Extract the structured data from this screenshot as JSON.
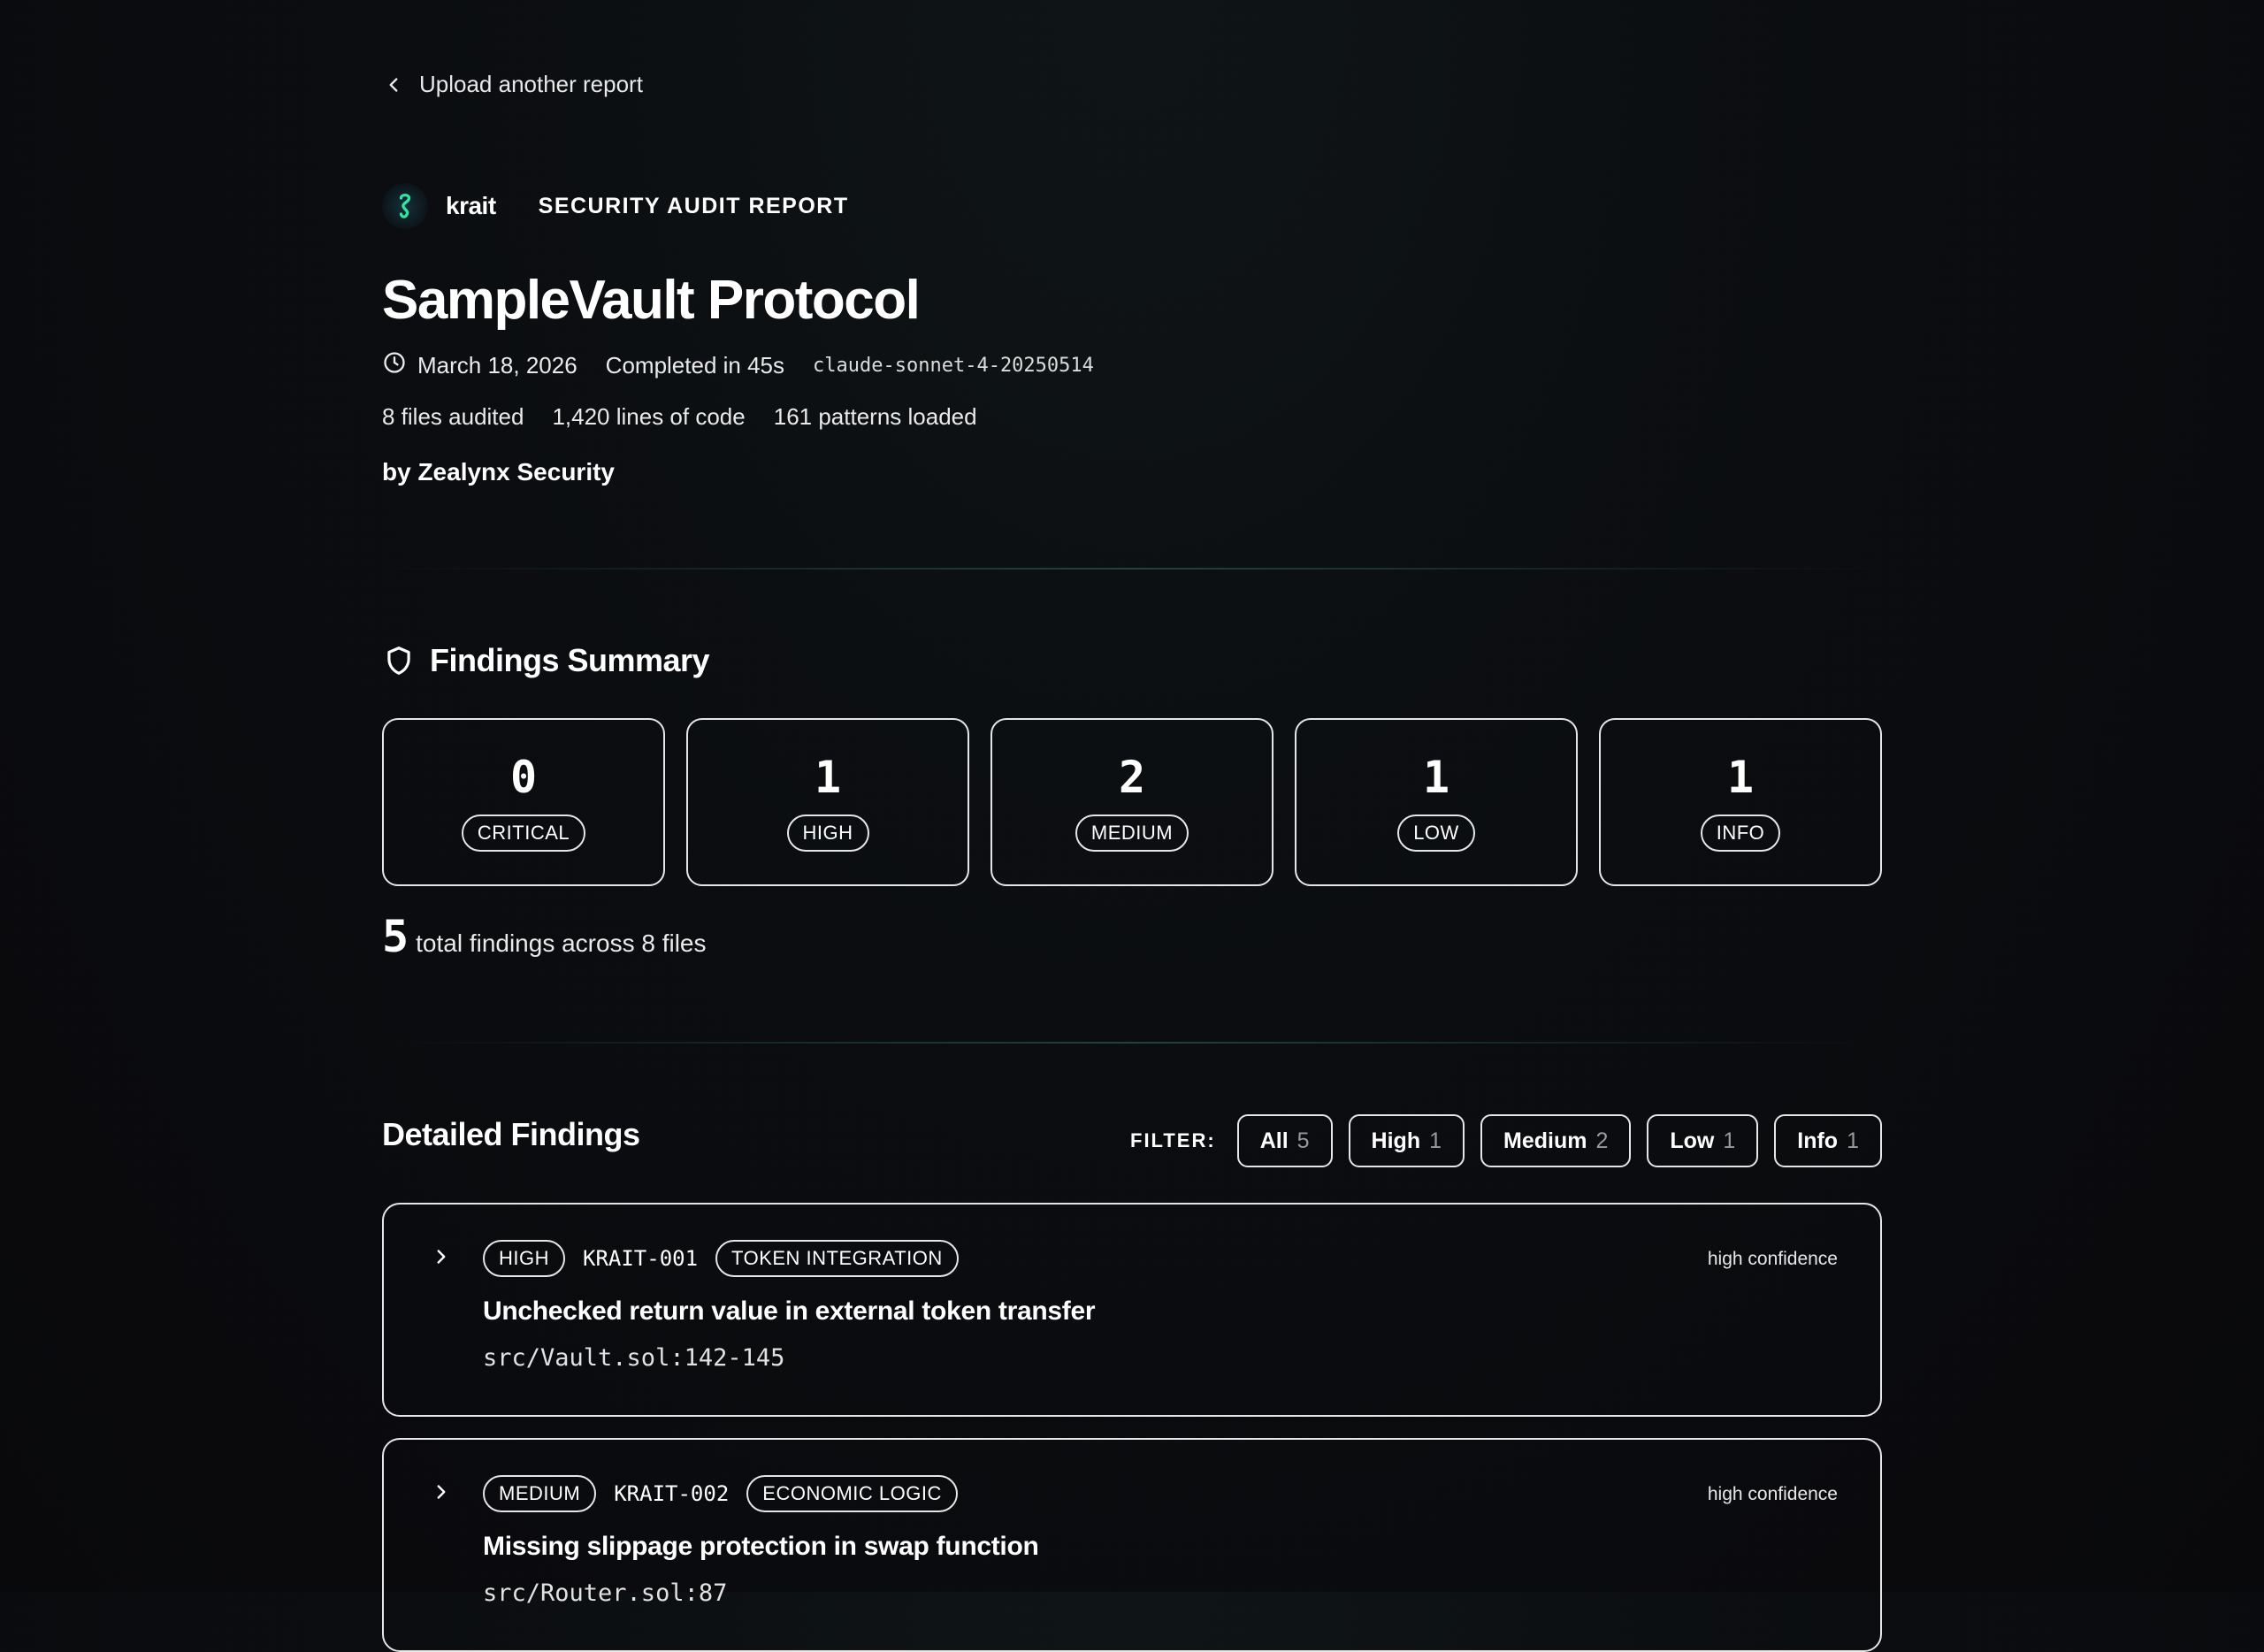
{
  "nav": {
    "back_label": "Upload another report"
  },
  "brand": {
    "name": "krait",
    "report_kind": "SECURITY AUDIT REPORT",
    "accent": "#2ee6a0"
  },
  "report": {
    "title": "SampleVault Protocol",
    "date": "March 18, 2026",
    "duration": "Completed in 45s",
    "model": "claude-sonnet-4-20250514",
    "files_audited": "8 files audited",
    "lines_of_code": "1,420 lines of code",
    "patterns_loaded": "161 patterns loaded",
    "byline": "by Zealynx Security"
  },
  "summary": {
    "heading": "Findings Summary",
    "cards": [
      {
        "count": "0",
        "label": "CRITICAL"
      },
      {
        "count": "1",
        "label": "HIGH"
      },
      {
        "count": "2",
        "label": "MEDIUM"
      },
      {
        "count": "1",
        "label": "LOW"
      },
      {
        "count": "1",
        "label": "INFO"
      }
    ],
    "total_count": "5",
    "total_text": "total findings across 8 files"
  },
  "findings": {
    "heading": "Detailed Findings",
    "filter_label": "FILTER:",
    "filters": [
      {
        "label": "All",
        "count": "5"
      },
      {
        "label": "High",
        "count": "1"
      },
      {
        "label": "Medium",
        "count": "2"
      },
      {
        "label": "Low",
        "count": "1"
      },
      {
        "label": "Info",
        "count": "1"
      }
    ],
    "items": [
      {
        "severity": "HIGH",
        "id": "KRAIT-001",
        "category": "TOKEN INTEGRATION",
        "confidence": "high confidence",
        "title": "Unchecked return value in external token transfer",
        "location": "src/Vault.sol:142-145"
      },
      {
        "severity": "MEDIUM",
        "id": "KRAIT-002",
        "category": "ECONOMIC LOGIC",
        "confidence": "high confidence",
        "title": "Missing slippage protection in swap function",
        "location": "src/Router.sol:87"
      }
    ]
  }
}
